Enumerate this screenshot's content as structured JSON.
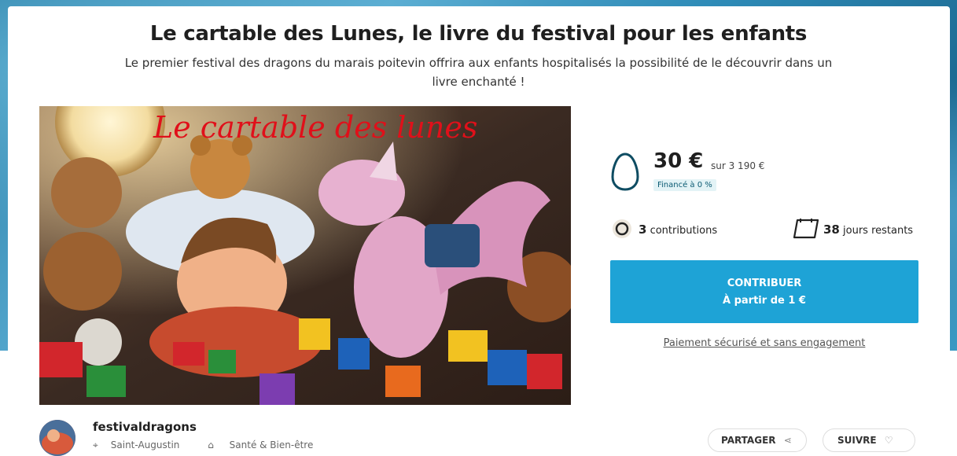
{
  "project": {
    "title": "Le cartable des Lunes, le livre du festival pour les enfants",
    "subtitle": "Le premier festival des dragons du marais poitevin offrira aux enfants hospitalisés la possibilité de le découvrir dans un livre enchanté !",
    "hero_image_text": "Le cartable des lunes"
  },
  "funding": {
    "amount": "30 €",
    "goal": "sur 3 190 €",
    "funded_badge": "Financé à 0 %",
    "funded_fraction": 0.0,
    "contributions_count": "3",
    "contributions_label": "contributions",
    "days_count": "38",
    "days_label": "jours restants"
  },
  "cta": {
    "line1": "CONTRIBUER",
    "line2": "À partir de 1 €"
  },
  "secure_link": "Paiement sécurisé et sans engagement",
  "author": {
    "name": "festivaldragons",
    "location": "Saint-Augustin",
    "category": "Santé & Bien-être"
  },
  "actions": {
    "share_label": "PARTAGER",
    "follow_label": "SUIVRE"
  },
  "colors": {
    "accent": "#1ea3d6",
    "egg_stroke": "#0e4c62",
    "hero_title": "#e0101a"
  }
}
